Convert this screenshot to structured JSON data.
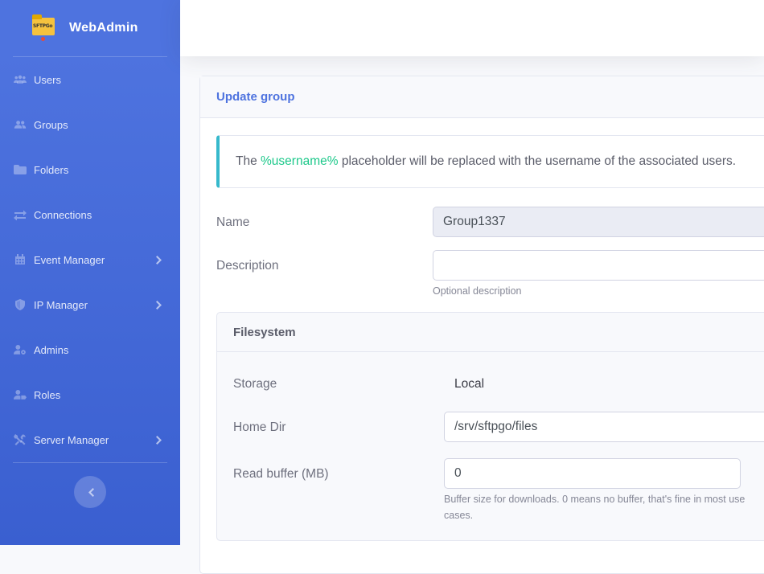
{
  "brand": {
    "name": "WebAdmin",
    "logo_text": "SFTPGo"
  },
  "sidebar": {
    "items": [
      {
        "label": "Users",
        "icon": "users-icon",
        "has_submenu": false
      },
      {
        "label": "Groups",
        "icon": "user-group-icon",
        "has_submenu": false
      },
      {
        "label": "Folders",
        "icon": "folder-icon",
        "has_submenu": false
      },
      {
        "label": "Connections",
        "icon": "exchange-icon",
        "has_submenu": false
      },
      {
        "label": "Event Manager",
        "icon": "calendar-icon",
        "has_submenu": true
      },
      {
        "label": "IP Manager",
        "icon": "shield-icon",
        "has_submenu": true
      },
      {
        "label": "Admins",
        "icon": "user-cog-icon",
        "has_submenu": false
      },
      {
        "label": "Roles",
        "icon": "user-tag-icon",
        "has_submenu": false
      },
      {
        "label": "Server Manager",
        "icon": "tools-icon",
        "has_submenu": true
      }
    ]
  },
  "card": {
    "title": "Update group"
  },
  "alert": {
    "prefix": "The ",
    "highlight": "%username%",
    "suffix": " placeholder will be replaced with the username of the associated users."
  },
  "form": {
    "name_label": "Name",
    "name_value": "Group1337",
    "description_label": "Description",
    "description_value": "",
    "description_help": "Optional description"
  },
  "filesystem": {
    "title": "Filesystem",
    "storage_label": "Storage",
    "storage_value": "Local",
    "home_dir_label": "Home Dir",
    "home_dir_value": "/srv/sftpgo/files",
    "read_buffer_label": "Read buffer (MB)",
    "read_buffer_value": "0",
    "read_buffer_help": "Buffer size for downloads. 0 means no buffer, that's fine in most use cases."
  },
  "colors": {
    "sidebar": "#4e73df",
    "accent": "#4e73df",
    "alert_border": "#36b9cc",
    "highlight": "#1cc88a"
  }
}
